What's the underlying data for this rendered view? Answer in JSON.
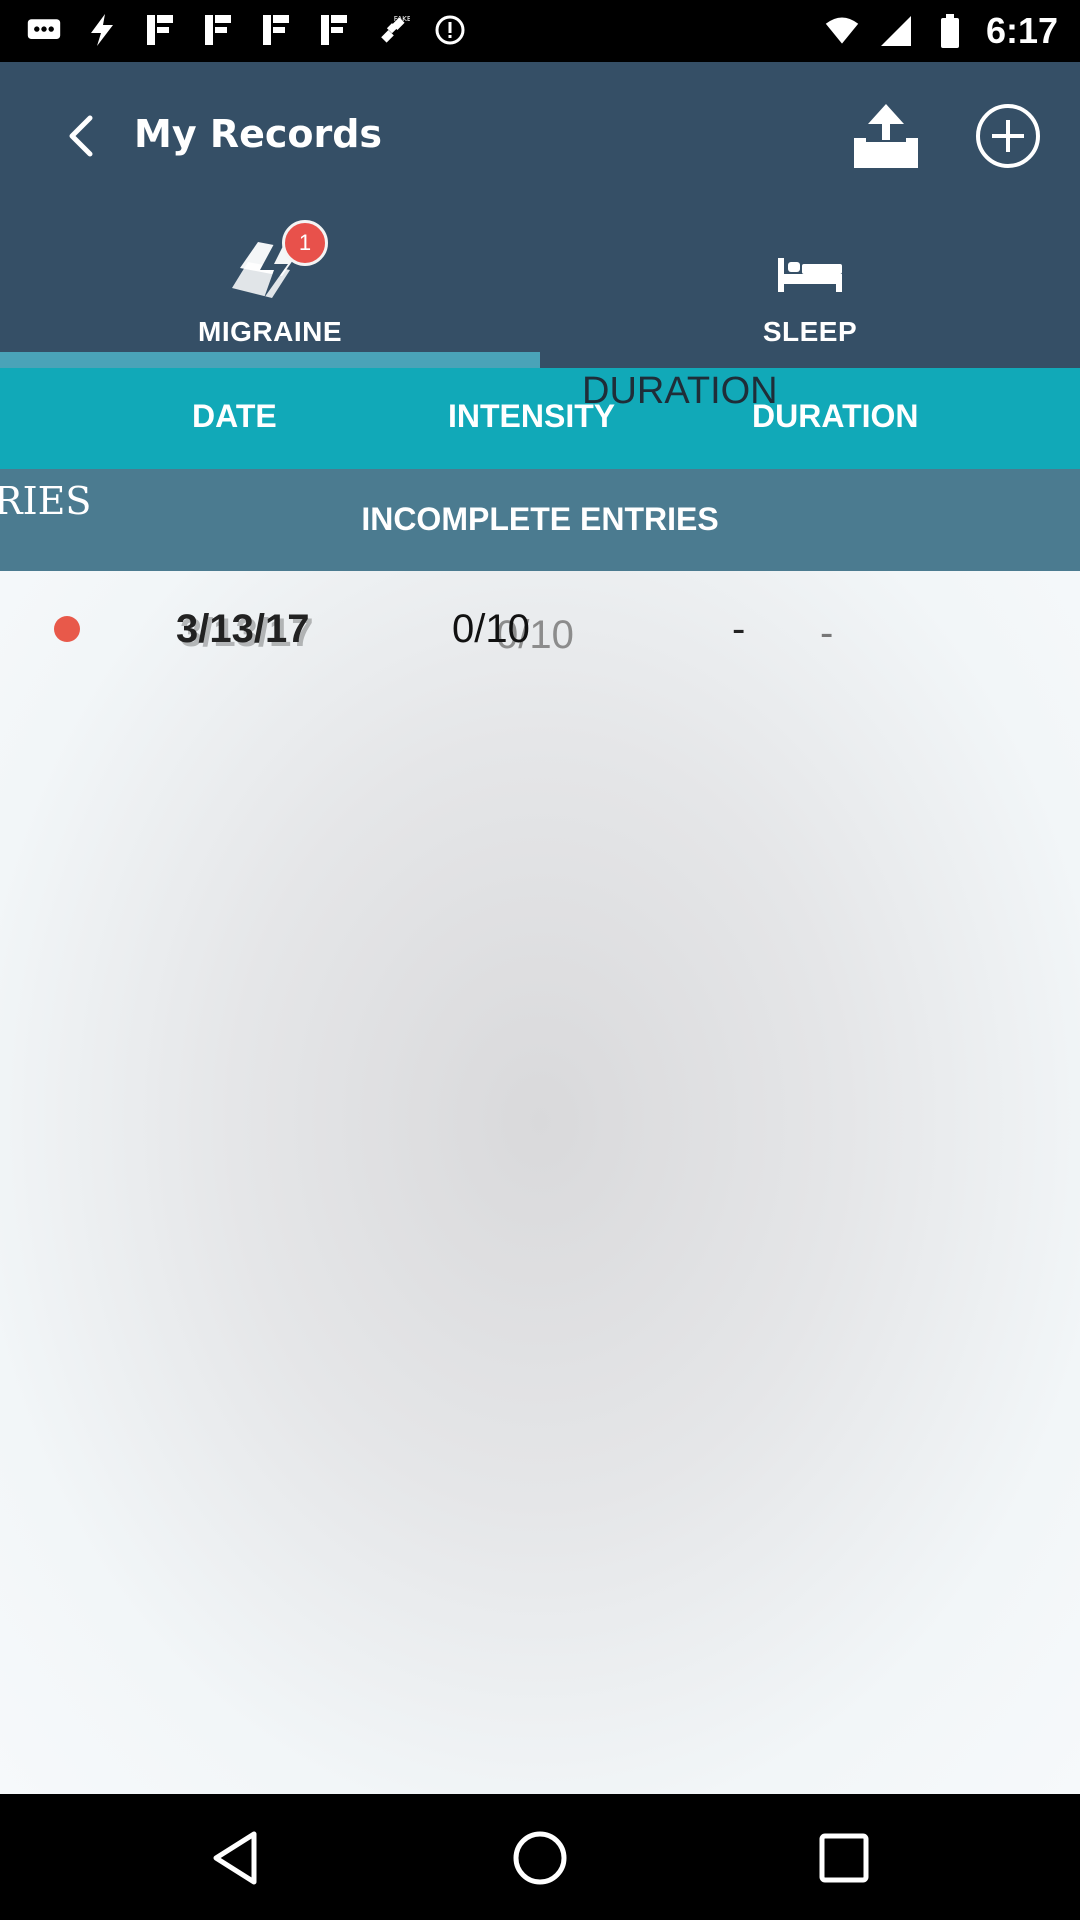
{
  "status_bar": {
    "time": "6:17",
    "icons": [
      "chat-icon",
      "flash-icon",
      "notification-icon",
      "notification-icon",
      "notification-icon",
      "notification-icon",
      "fake-gps-icon",
      "info-icon",
      "wifi-icon",
      "signal-icon",
      "battery-icon"
    ]
  },
  "app_bar": {
    "title": "My Records",
    "back_icon": "chevron-left-icon",
    "export_icon": "export-icon",
    "add_icon": "add-circle-icon"
  },
  "tabs": [
    {
      "label": "MIGRAINE",
      "icon": "lightning-icon",
      "badge": "1",
      "selected": true
    },
    {
      "label": "SLEEP",
      "icon": "bed-icon",
      "selected": false
    }
  ],
  "columns": {
    "date": "DATE",
    "intensity": "INTENSITY",
    "duration": "DURATION",
    "overlap_duration": "DURATION"
  },
  "section": {
    "title": "INCOMPLETE ENTRIES",
    "peek": "RIES"
  },
  "entries": [
    {
      "date": "3/13/17",
      "intensity": "0/10",
      "intensity_ghost": "0/10",
      "duration": "-",
      "extra": "-",
      "status_color": "#e8594a"
    }
  ],
  "colors": {
    "app_bar": "#354f66",
    "header_row": "#11a9b8",
    "section": "#4b7b90",
    "indicator": "#4aa3b8",
    "badge": "#e8514b"
  }
}
